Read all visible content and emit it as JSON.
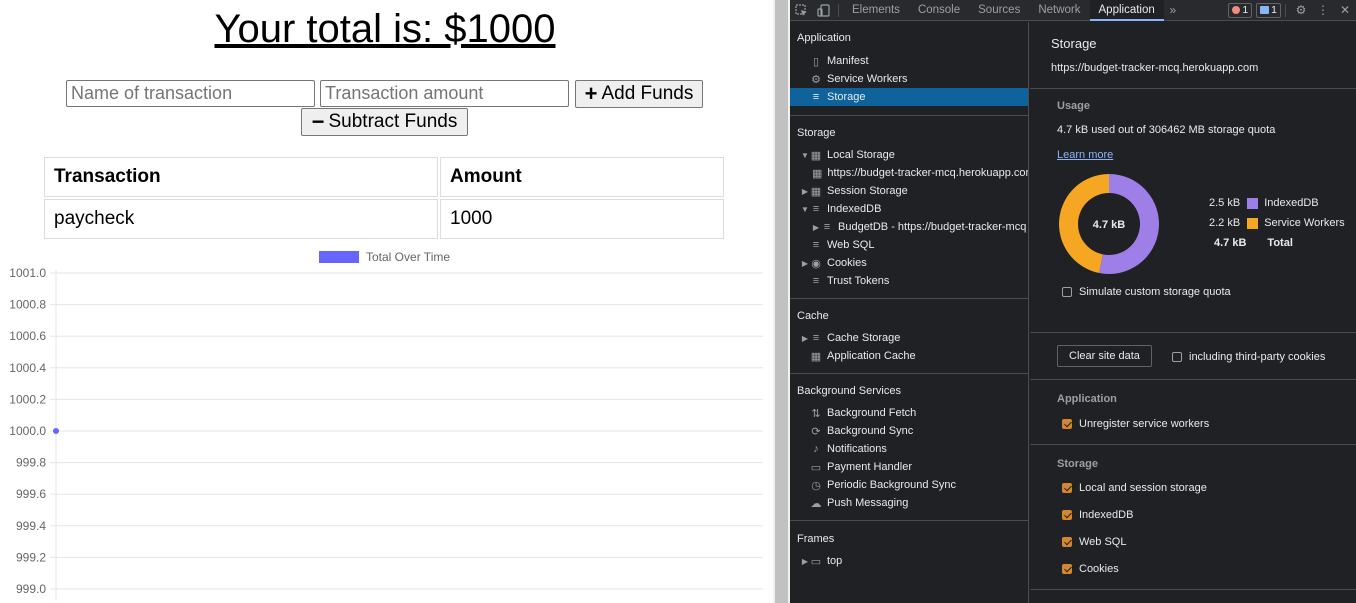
{
  "page": {
    "total_label": "Your total is: $1000",
    "name_placeholder": "Name of transaction",
    "amount_placeholder": "Transaction amount",
    "add_label": "Add Funds",
    "subtract_label": "Subtract Funds",
    "table": {
      "headers": [
        "Transaction",
        "Amount"
      ],
      "rows": [
        [
          "paycheck",
          "1000"
        ]
      ]
    }
  },
  "chart_data": {
    "type": "line",
    "series": [
      {
        "name": "Total Over Time",
        "values": [
          1000.0
        ]
      }
    ],
    "y_ticks": [
      "1001.0",
      "1000.8",
      "1000.6",
      "1000.4",
      "1000.2",
      "1000.0",
      "999.8",
      "999.6",
      "999.4",
      "999.2",
      "999.0"
    ],
    "ylim": [
      999.0,
      1001.0
    ],
    "grid": true,
    "legend": "top",
    "color": "#6666ff"
  },
  "devtools": {
    "tabs": [
      "Elements",
      "Console",
      "Sources",
      "Network",
      "Application"
    ],
    "active_tab": "Application",
    "error_count": "1",
    "message_count": "1",
    "sidebar": {
      "application_header": "Application",
      "application_items": [
        "Manifest",
        "Service Workers",
        "Storage"
      ],
      "storage_header": "Storage",
      "storage_items": [
        "Local Storage",
        "https://budget-tracker-mcq.herokuapp.com",
        "Session Storage",
        "IndexedDB",
        "BudgetDB - https://budget-tracker-mcq",
        "Web SQL",
        "Cookies",
        "Trust Tokens"
      ],
      "cache_header": "Cache",
      "cache_items": [
        "Cache Storage",
        "Application Cache"
      ],
      "bg_header": "Background Services",
      "bg_items": [
        "Background Fetch",
        "Background Sync",
        "Notifications",
        "Payment Handler",
        "Periodic Background Sync",
        "Push Messaging"
      ],
      "frames_header": "Frames",
      "frames_items": [
        "top"
      ]
    },
    "pane": {
      "title": "Storage",
      "origin": "https://budget-tracker-mcq.herokuapp.com",
      "usage_header": "Usage",
      "usage_text": "4.7 kB used out of 306462 MB storage quota",
      "learn_more": "Learn more",
      "donut_center": "4.7 kB",
      "donut_slices": [
        {
          "name": "IndexedDB",
          "value": 2.5,
          "label": "2.5 kB",
          "color": "#9e7fe8"
        },
        {
          "name": "Service Workers",
          "value": 2.2,
          "label": "2.2 kB",
          "color": "#f5a623"
        }
      ],
      "total_value": "4.7 kB",
      "total_label": "Total",
      "simulate_label": "Simulate custom storage quota",
      "clear_button": "Clear site data",
      "third_party_label": "including third-party cookies",
      "app_header": "Application",
      "unregister_label": "Unregister service workers",
      "storage_header": "Storage",
      "storage_checks": [
        "Local and session storage",
        "IndexedDB",
        "Web SQL",
        "Cookies"
      ]
    }
  }
}
